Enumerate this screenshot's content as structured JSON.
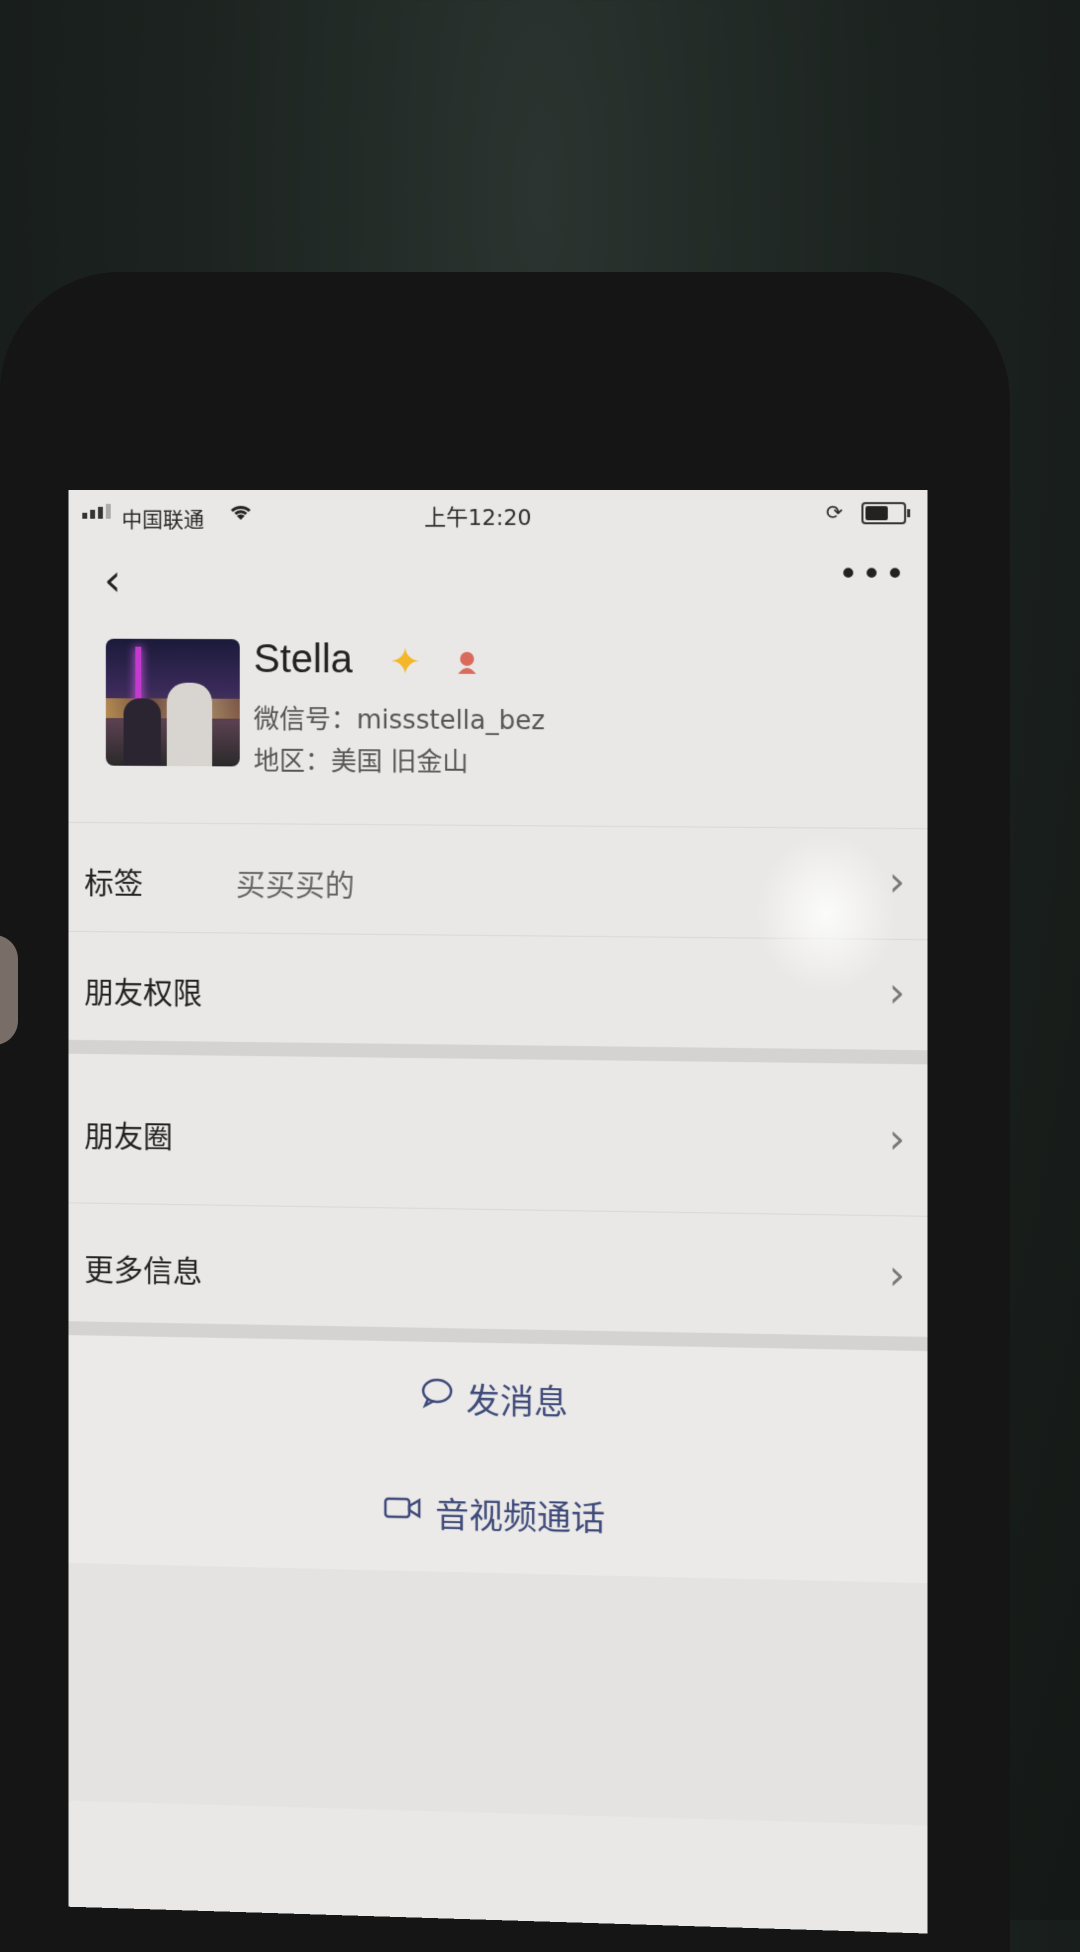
{
  "status_bar": {
    "carrier": "中国联通",
    "time": "上午12:20"
  },
  "header": {
    "back_glyph": "‹",
    "more_glyph": "•••"
  },
  "profile": {
    "name": "Stella",
    "wechat_id": "微信号：missstella_bez",
    "region": "地区：美国 旧金山"
  },
  "rows": [
    {
      "label": "标签",
      "value": "买买买的"
    },
    {
      "label": "朋友权限"
    },
    {
      "label": "朋友圈"
    },
    {
      "label": "更多信息"
    }
  ],
  "actions": {
    "message": "发消息",
    "video_call": "音视频通话"
  },
  "icons": {
    "star": "star-badge-icon",
    "gender": "female-gender-icon",
    "chat": "chat-bubble-icon",
    "video": "video-camera-icon"
  },
  "colors": {
    "action_text": "#3e4a7a",
    "star": "#f3b728",
    "gender": "#d96a5c"
  }
}
